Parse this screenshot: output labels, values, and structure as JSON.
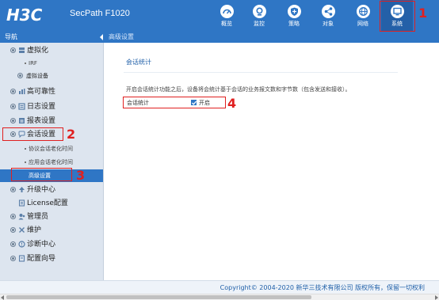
{
  "header": {
    "logo": "H3C",
    "product": "SecPath F1020",
    "nav": [
      {
        "label": "概览",
        "icon": "gauge-icon"
      },
      {
        "label": "监控",
        "icon": "camera-icon"
      },
      {
        "label": "策略",
        "icon": "shield-icon"
      },
      {
        "label": "对象",
        "icon": "share-icon"
      },
      {
        "label": "网络",
        "icon": "globe-icon"
      },
      {
        "label": "系统",
        "icon": "monitor-icon"
      }
    ]
  },
  "sidebar": {
    "title": "导航",
    "items": [
      {
        "label": "虚拟化",
        "type": "group",
        "icon": "virtual-icon"
      },
      {
        "label": "IRF",
        "type": "sub"
      },
      {
        "label": "虚拟设备",
        "type": "subgroup"
      },
      {
        "label": "高可靠性",
        "type": "group",
        "icon": "reliability-icon"
      },
      {
        "label": "日志设置",
        "type": "group",
        "icon": "log-icon"
      },
      {
        "label": "报表设置",
        "type": "group",
        "icon": "report-icon"
      },
      {
        "label": "会话设置",
        "type": "group",
        "icon": "session-icon"
      },
      {
        "label": "协议会话老化时间",
        "type": "sub"
      },
      {
        "label": "应用会话老化时间",
        "type": "sub"
      },
      {
        "label": "高级设置",
        "type": "sub",
        "selected": true
      },
      {
        "label": "升级中心",
        "type": "group",
        "icon": "upgrade-icon"
      },
      {
        "label": "License配置",
        "type": "group",
        "icon": "license-icon"
      },
      {
        "label": "管理员",
        "type": "group",
        "icon": "admin-icon"
      },
      {
        "label": "维护",
        "type": "group",
        "icon": "wrench-icon"
      },
      {
        "label": "诊断中心",
        "type": "group",
        "icon": "diagnosis-icon"
      },
      {
        "label": "配置向导",
        "type": "group",
        "icon": "wizard-icon"
      }
    ]
  },
  "breadcrumb": "高级设置",
  "content": {
    "section_title": "会话统计",
    "description": "开启会话统计功能之后，设备将会统计基于会话的业务报文数和字节数（包含发送和接收）。",
    "field_label": "会话统计",
    "checkbox_label": "开启",
    "checkbox_checked": true
  },
  "annotations": [
    "1",
    "2",
    "3",
    "4"
  ],
  "footer": {
    "copyright": "Copyright© 2004-2020 新华三技术有限公司 版权所有，保留一切权利"
  },
  "colors": {
    "brand_blue": "#2f76c5",
    "sidebar_bg": "#dde5ef",
    "annotation_red": "#e02020"
  }
}
